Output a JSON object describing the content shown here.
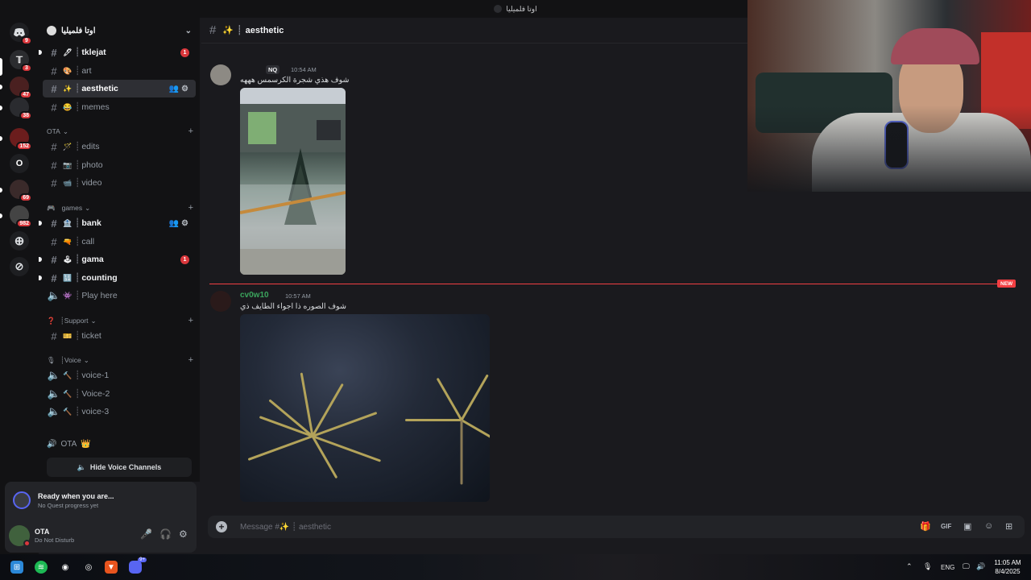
{
  "window": {
    "title": "اوتا فلميليا"
  },
  "servers": [
    {
      "label": "",
      "badge": "9"
    },
    {
      "label": "",
      "badge": "3"
    },
    {
      "label": "",
      "badge": "47"
    },
    {
      "label": "",
      "badge": "38"
    },
    {
      "label": "",
      "badge": "152"
    },
    {
      "label": "O",
      "badge": ""
    },
    {
      "label": "",
      "badge": "69"
    },
    {
      "label": "",
      "badge": "982"
    }
  ],
  "guild": {
    "name": "اوتا فلميليا"
  },
  "channels": {
    "top": [
      {
        "emoji": "🖊",
        "name": "tklejat",
        "unread": "1"
      },
      {
        "emoji": "🎨",
        "name": "art"
      },
      {
        "emoji": "✨",
        "name": "aesthetic"
      },
      {
        "emoji": "😂",
        "name": "memes"
      }
    ],
    "cat_ota": "OTA",
    "ota": [
      {
        "emoji": "🪄",
        "name": "edits"
      },
      {
        "emoji": "📷",
        "name": "photo"
      },
      {
        "emoji": "📹",
        "name": "video"
      }
    ],
    "cat_games": "games",
    "games": [
      {
        "emoji": "🏦",
        "name": "bank"
      },
      {
        "emoji": "🔫",
        "name": "call"
      },
      {
        "emoji": "🕹",
        "name": "gama",
        "unread": "1"
      },
      {
        "emoji": "🔢",
        "name": "counting"
      },
      {
        "emoji": "👾",
        "name": "Play here"
      }
    ],
    "cat_support": "Support",
    "support": [
      {
        "emoji": "🎫",
        "name": "ticket"
      }
    ],
    "cat_voice": "Voice",
    "voice": [
      {
        "emoji": "🔨",
        "name": "voice-1"
      },
      {
        "emoji": "🔨",
        "name": "Voice-2"
      },
      {
        "emoji": "🔨",
        "name": "voice-3"
      }
    ],
    "ota_voice": "OTA",
    "hide_voice": "Hide Voice Channels"
  },
  "quest": {
    "title": "Ready when you are...",
    "subtitle": "No Quest progress yet"
  },
  "user": {
    "name": "OTA",
    "status": "Do Not Disturb"
  },
  "chat": {
    "channel_name": "aesthetic",
    "messages": [
      {
        "author": "",
        "tag": "NQ",
        "time": "10:54 AM",
        "text": "شوف هذي شجرة الكرسمس هههه"
      },
      {
        "author": "cv0w10",
        "time": "10:57 AM",
        "text": "شوف الصوره ذا اجواء الطايف ذي"
      }
    ],
    "new_label": "NEW",
    "composer_placeholder": "Message #✨ ┊ aesthetic"
  },
  "taskbar": {
    "lang": "ENG",
    "time": "11:05 AM",
    "date": "8/4/2025",
    "discord_badge": "9+"
  },
  "colors": {
    "accent": "#5865f2",
    "danger": "#da373c",
    "online": "#23a55a",
    "author2": "#3ba55d"
  }
}
